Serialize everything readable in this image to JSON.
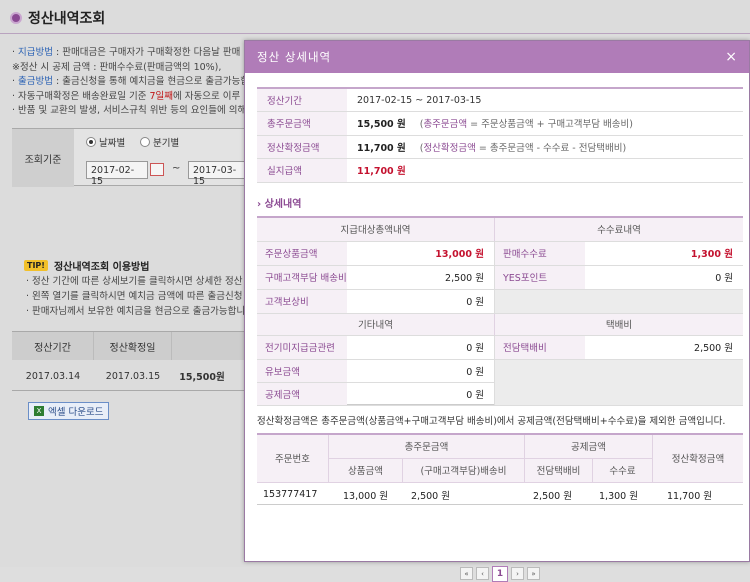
{
  "page": {
    "title": "정산내역조회",
    "notes": [
      {
        "key": "지급방법",
        "text": " : 판매대금은 구매자가 구매확정한 다음날 판매"
      },
      {
        "key": "",
        "text": "※정산 시 공제 금액 : 판매수수료(판매금액의 10%),"
      },
      {
        "key": "출금방법",
        "text": " : 출금신청을 통해 예치금을 현금으로 출금가능합"
      },
      {
        "key": "",
        "text": "자동구매확정은 배송완료일 기준 ",
        "red": "7일째",
        "rest": "에 자동으로 이루"
      },
      {
        "key": "",
        "text": "반품 및 교환의 발생, 서비스규칙 위반 등의 요인들에 의해"
      }
    ],
    "search": {
      "label": "조회기준",
      "radio_day": "날짜별",
      "radio_quarter": "분기별",
      "date_from": "2017-02-15",
      "date_to": "2017-03-15",
      "tilde": "~"
    },
    "tip": {
      "badge": "TIP!",
      "title": "정산내역조회 이용방법",
      "lines": [
        "· 정산 기간에 따른 상세보기를 클릭하시면 상세한 정산",
        "· 왼쪽 열기를 클릭하시면 예치금 금액에 따른 출금신청",
        "· 판매자님께서 보유한 예치금을 현금으로 출금가능합니"
      ]
    },
    "table": {
      "headers": [
        "정산기간",
        "정산확정일"
      ],
      "row": [
        "2017.03.14",
        "2017.03.15",
        "15,500원"
      ]
    },
    "excel_button": "엑셀 다운로드"
  },
  "modal": {
    "title": "정산 상세내역",
    "close": "×",
    "summary": {
      "period_label": "정산기간",
      "period_value": "2017-02-15 ~ 2017-03-15",
      "total_label": "총주문금액",
      "total_value": "15,500 원",
      "total_ex_key": "총주문금액",
      "total_ex_rest": " = 주문상품금액 + 구매고객부담 배송비)",
      "confirmed_label": "정산확정금액",
      "confirmed_value": "11,700 원",
      "confirmed_ex_key": "정산확정금액",
      "confirmed_ex_rest": " = 총주문금액 - 수수료 - 전담택배비)",
      "paid_label": "실지급액",
      "paid_value": "11,700 원"
    },
    "detail": {
      "section_title": "상세내역",
      "payout_header": "지급대상총액내역",
      "fee_header": "수수료내역",
      "order_amount_label": "주문상품금액",
      "order_amount_value": "13,000 원",
      "sales_fee_label": "판매수수료",
      "sales_fee_value": "1,300 원",
      "shipping_label": "구매고객부담 배송비",
      "shipping_value": "2,500 원",
      "yes_point_label": "YES포인트",
      "yes_point_value": "0 원",
      "comp_label": "고객보상비",
      "comp_value": "0 원",
      "other_header": "기타내역",
      "courier_header": "택배비",
      "prev_label": "전기미지급금관련",
      "prev_value": "0 원",
      "courier_label": "전담택배비",
      "courier_value": "2,500 원",
      "hold_label": "유보금액",
      "hold_value": "0 원",
      "deduct_label": "공제금액",
      "deduct_value": "0 원"
    },
    "note": "정산확정금액은 총주문금액(상품금액+구매고객부담 배송비)에서 공제금액(전담택배비+수수료)을 제외한 금액입니다.",
    "bottom_table": {
      "h_order_no": "주문번호",
      "h_total": "총주문금액",
      "h_deduct": "공제금액",
      "h_confirmed": "정산확정금액",
      "h_product": "상품금액",
      "h_shipping": "(구매고객부담)배송비",
      "h_courier": "전담택배비",
      "h_fee": "수수료",
      "order_no": "153777417",
      "product": "13,000 원",
      "shipping": "2,500 원",
      "courier": "2,500 원",
      "fee": "1,300 원",
      "confirmed": "11,700 원"
    },
    "pager": {
      "first": "«",
      "prev": "‹",
      "current": "1",
      "next": "›",
      "last": "»"
    }
  }
}
